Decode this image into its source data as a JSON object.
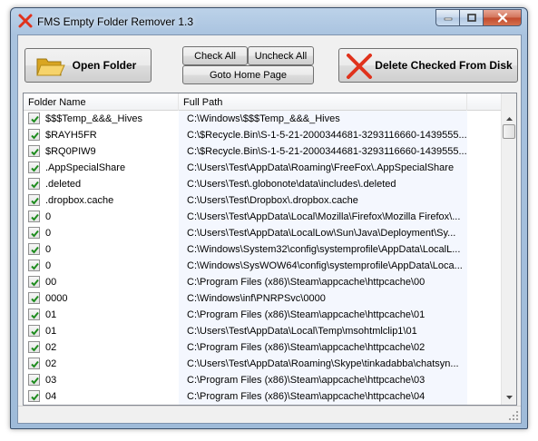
{
  "window": {
    "title": "FMS Empty Folder Remover 1.3"
  },
  "toolbar": {
    "open_folder": "Open Folder",
    "check_all": "Check All",
    "uncheck_all": "Uncheck All",
    "goto_home": "Goto Home Page",
    "delete_checked": "Delete Checked From Disk"
  },
  "icons": {
    "app": "red-x-icon",
    "open_folder": "folder-open-icon",
    "delete": "red-x-icon"
  },
  "colors": {
    "accent_red": "#e0321c",
    "folder_yellow": "#f2c94c",
    "check_green": "#1e8c1e"
  },
  "list": {
    "columns": [
      "Folder Name",
      "Full Path"
    ],
    "rows": [
      {
        "checked": true,
        "name": "$$$Temp_&&&_Hives",
        "path": "C:\\Windows\\$$$Temp_&&&_Hives"
      },
      {
        "checked": true,
        "name": "$RAYH5FR",
        "path": "C:\\$Recycle.Bin\\S-1-5-21-2000344681-3293116660-1439555..."
      },
      {
        "checked": true,
        "name": "$RQ0PIW9",
        "path": "C:\\$Recycle.Bin\\S-1-5-21-2000344681-3293116660-1439555..."
      },
      {
        "checked": true,
        "name": ".AppSpecialShare",
        "path": "C:\\Users\\Test\\AppData\\Roaming\\FreeFox\\.AppSpecialShare"
      },
      {
        "checked": true,
        "name": ".deleted",
        "path": "C:\\Users\\Test\\.globonote\\data\\includes\\.deleted"
      },
      {
        "checked": true,
        "name": ".dropbox.cache",
        "path": "C:\\Users\\Test\\Dropbox\\.dropbox.cache"
      },
      {
        "checked": true,
        "name": "0",
        "path": "C:\\Users\\Test\\AppData\\Local\\Mozilla\\Firefox\\Mozilla Firefox\\..."
      },
      {
        "checked": true,
        "name": "0",
        "path": "C:\\Users\\Test\\AppData\\LocalLow\\Sun\\Java\\Deployment\\Sy..."
      },
      {
        "checked": true,
        "name": "0",
        "path": "C:\\Windows\\System32\\config\\systemprofile\\AppData\\LocalL..."
      },
      {
        "checked": true,
        "name": "0",
        "path": "C:\\Windows\\SysWOW64\\config\\systemprofile\\AppData\\Loca..."
      },
      {
        "checked": true,
        "name": "00",
        "path": "C:\\Program Files (x86)\\Steam\\appcache\\httpcache\\00"
      },
      {
        "checked": true,
        "name": "0000",
        "path": "C:\\Windows\\inf\\PNRPSvc\\0000"
      },
      {
        "checked": true,
        "name": "01",
        "path": "C:\\Program Files (x86)\\Steam\\appcache\\httpcache\\01"
      },
      {
        "checked": true,
        "name": "01",
        "path": "C:\\Users\\Test\\AppData\\Local\\Temp\\msohtmlclip1\\01"
      },
      {
        "checked": true,
        "name": "02",
        "path": "C:\\Program Files (x86)\\Steam\\appcache\\httpcache\\02"
      },
      {
        "checked": true,
        "name": "02",
        "path": "C:\\Users\\Test\\AppData\\Roaming\\Skype\\tinkadabba\\chatsyn..."
      },
      {
        "checked": true,
        "name": "03",
        "path": "C:\\Program Files (x86)\\Steam\\appcache\\httpcache\\03"
      },
      {
        "checked": true,
        "name": "04",
        "path": "C:\\Program Files (x86)\\Steam\\appcache\\httpcache\\04"
      }
    ]
  }
}
